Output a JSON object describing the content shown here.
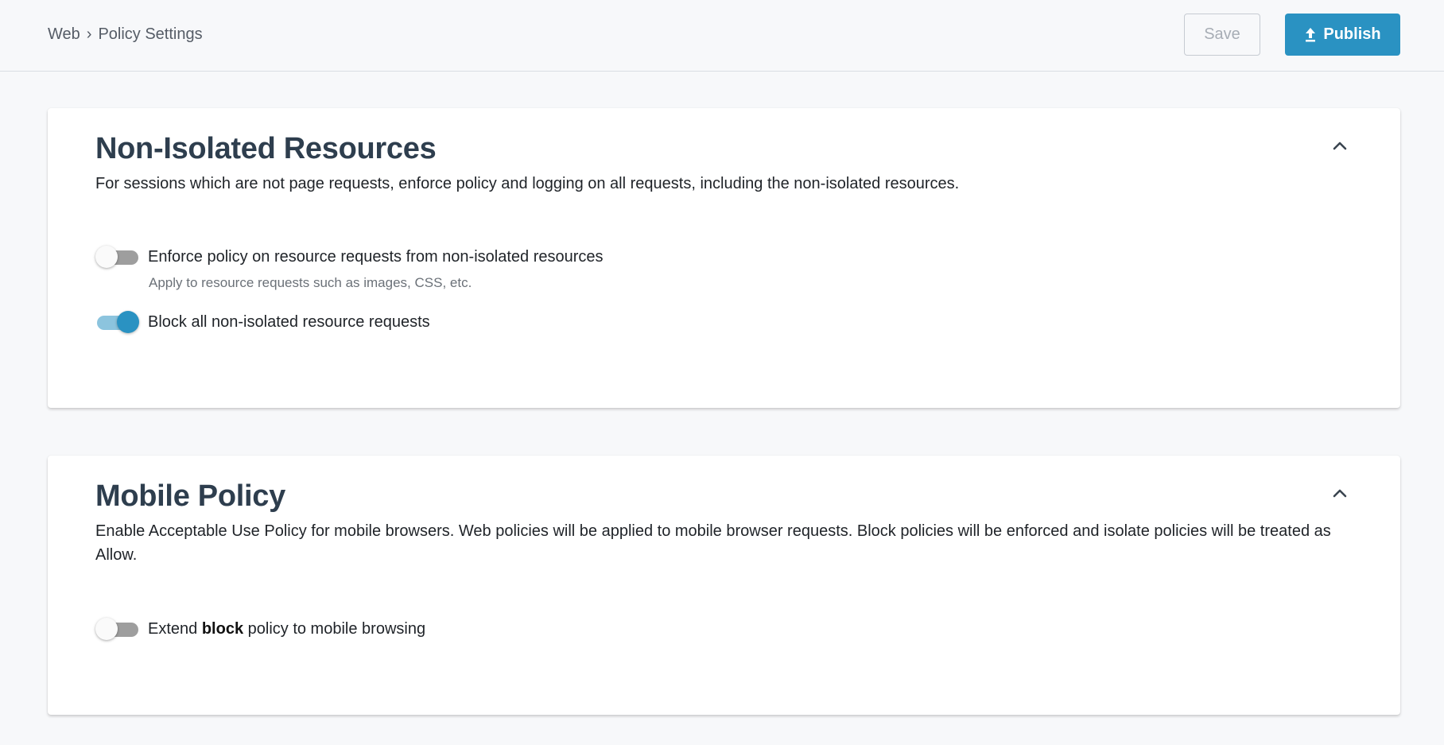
{
  "header": {
    "breadcrumb": [
      "Web",
      "Policy Settings"
    ],
    "breadcrumb_separator": "›",
    "save_label": "Save",
    "publish_label": "Publish",
    "publish_icon": "upload-icon",
    "accent_color": "#2a92c2"
  },
  "sections": [
    {
      "title": "Non-Isolated Resources",
      "description": "For sessions which are not page requests, enforce policy and logging on all requests, including the non-isolated resources.",
      "collapse_icon": "chevron-up-icon",
      "settings": [
        {
          "label": "Enforce policy on resource requests from non-isolated resources",
          "sublabel": "Apply to resource requests such as images, CSS, etc.",
          "enabled": false
        },
        {
          "label": "Block all non-isolated resource requests",
          "enabled": true
        }
      ]
    },
    {
      "title": "Mobile Policy",
      "description": "Enable Acceptable Use Policy for mobile browsers. Web policies will be applied to mobile browser requests. Block policies will be enforced and isolate policies will be treated as Allow.",
      "collapse_icon": "chevron-up-icon",
      "settings": [
        {
          "label_parts": [
            "Extend ",
            "block",
            " policy to mobile browsing"
          ],
          "enabled": false
        }
      ]
    }
  ]
}
